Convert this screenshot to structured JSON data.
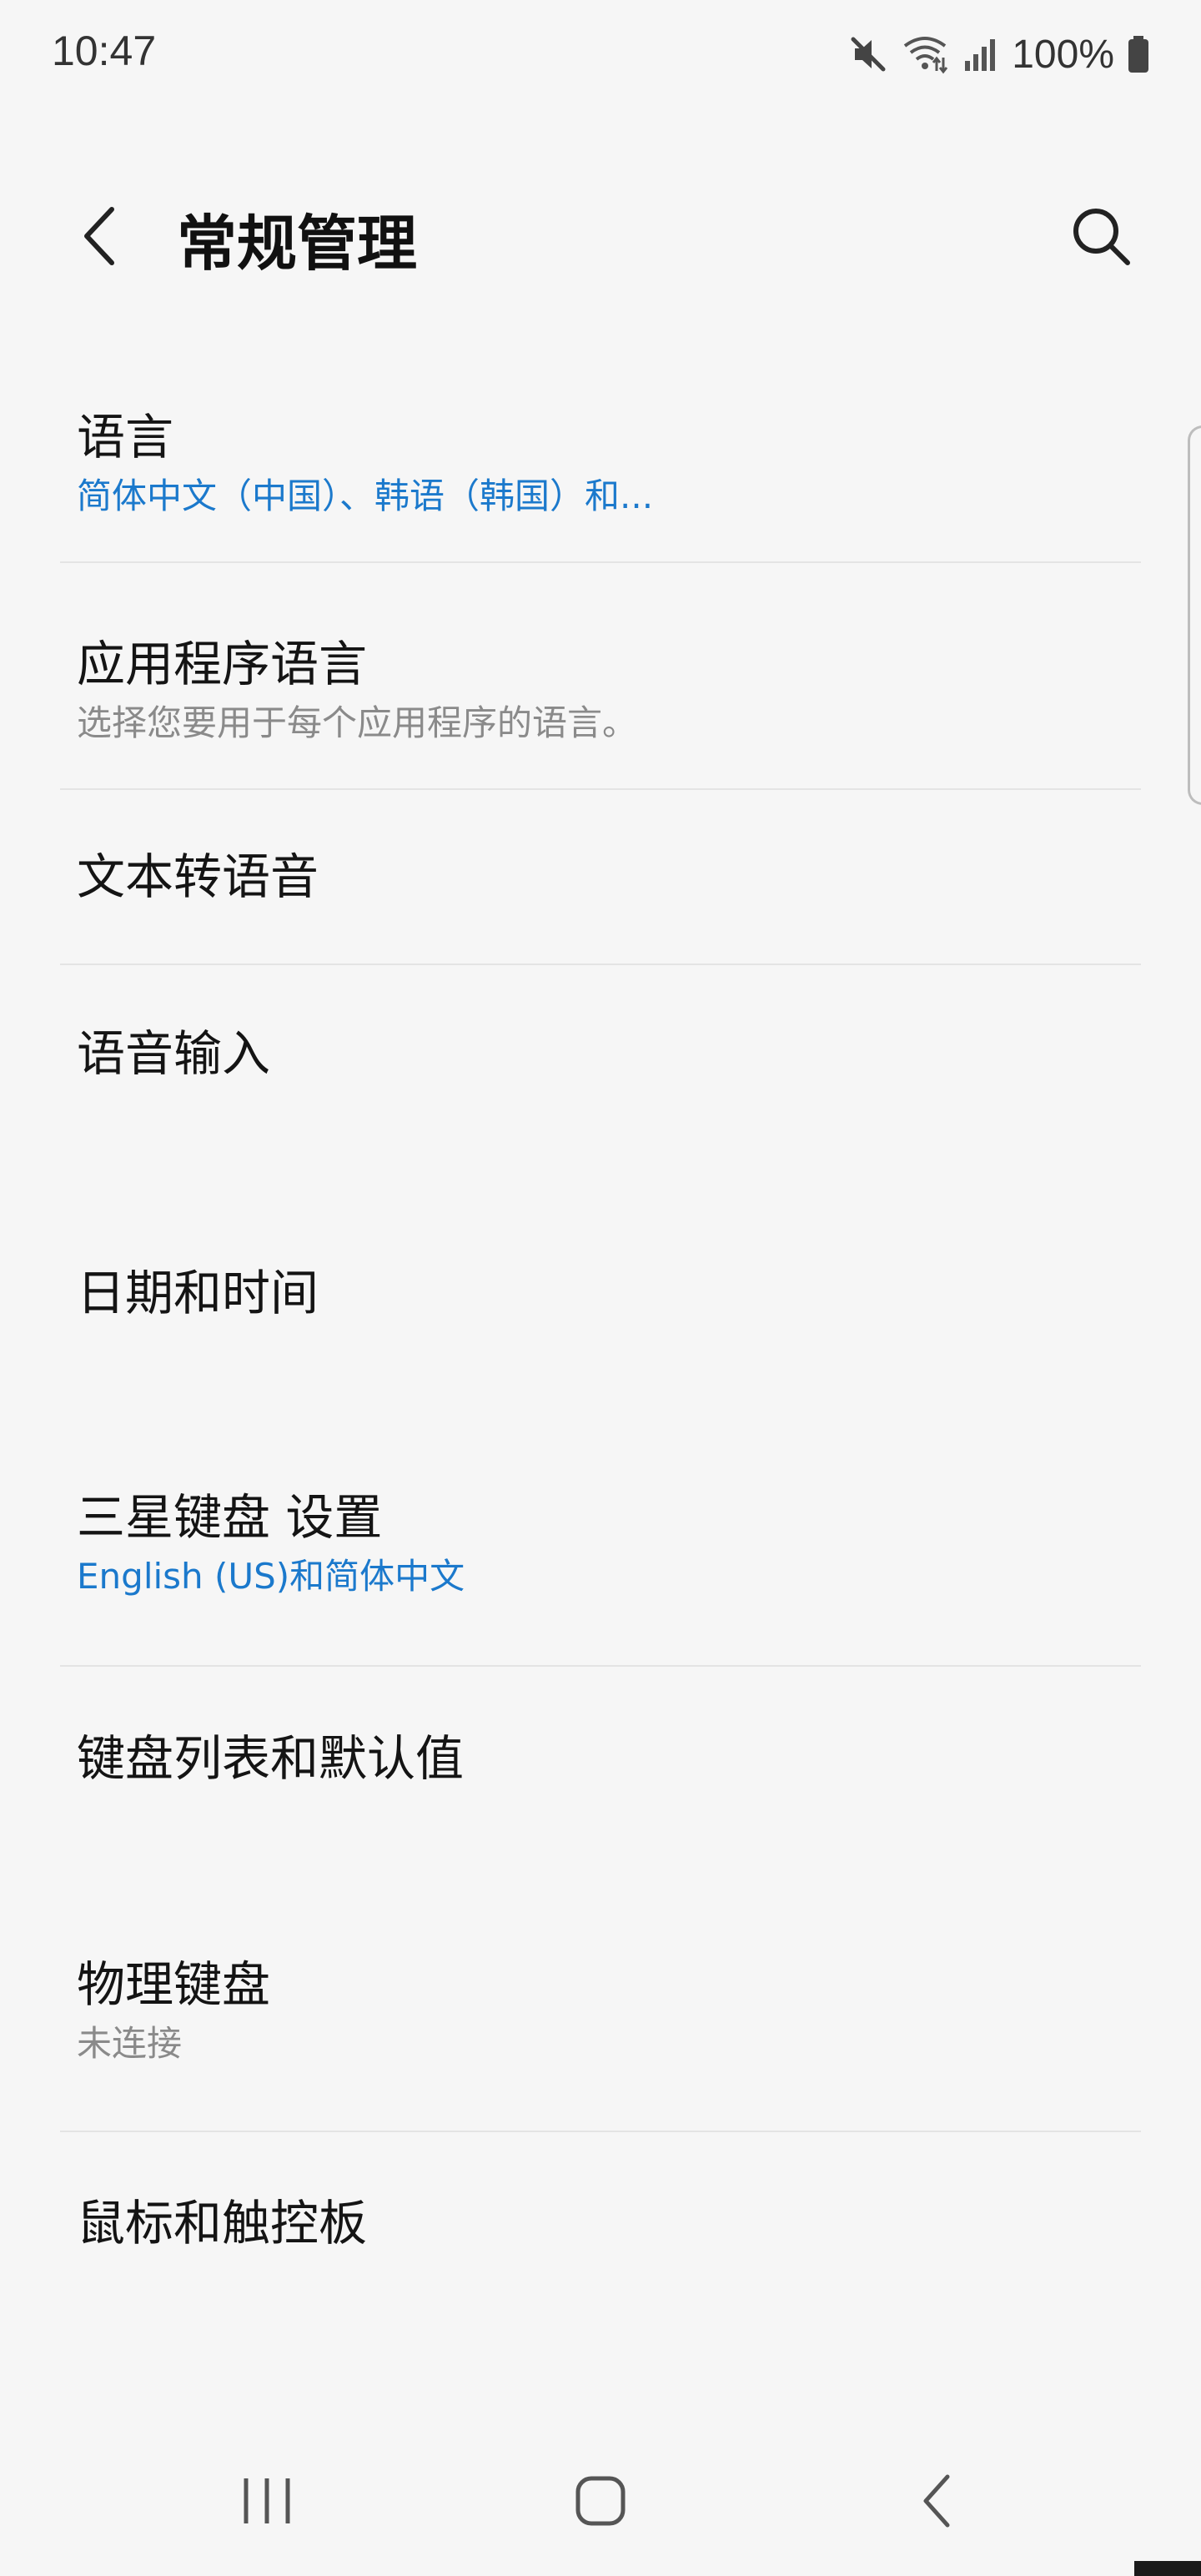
{
  "status_bar": {
    "time": "10:47",
    "battery": "100%",
    "icons": [
      "mute-icon",
      "wifi-icon",
      "signal-icon",
      "battery-icon"
    ]
  },
  "header": {
    "title": "常规管理",
    "back_icon": "back-chevron-icon",
    "search_icon": "search-icon"
  },
  "items": [
    {
      "title": "语言",
      "subtitle": "简体中文（中国）、韩语（韩国）和...",
      "subtitle_style": "accent"
    },
    {
      "title": "应用程序语言",
      "subtitle": "选择您要用于每个应用程序的语言。",
      "subtitle_style": "muted"
    },
    {
      "title": "文本转语音"
    },
    {
      "title": "语音输入"
    },
    {
      "title": "日期和时间"
    },
    {
      "title": "三星键盘 设置",
      "subtitle": "English (US)和简体中文",
      "subtitle_style": "accent"
    },
    {
      "title": "键盘列表和默认值"
    },
    {
      "title": "物理键盘",
      "subtitle": "未连接",
      "subtitle_style": "muted"
    },
    {
      "title": "鼠标和触控板"
    }
  ],
  "nav_bar": {
    "icons": [
      "recent-apps-icon",
      "home-icon",
      "back-icon"
    ]
  },
  "colors": {
    "background": "#f6f6f6",
    "accent": "#1b79cc",
    "muted": "#8a8a8a",
    "divider": "#e4e4e4"
  }
}
